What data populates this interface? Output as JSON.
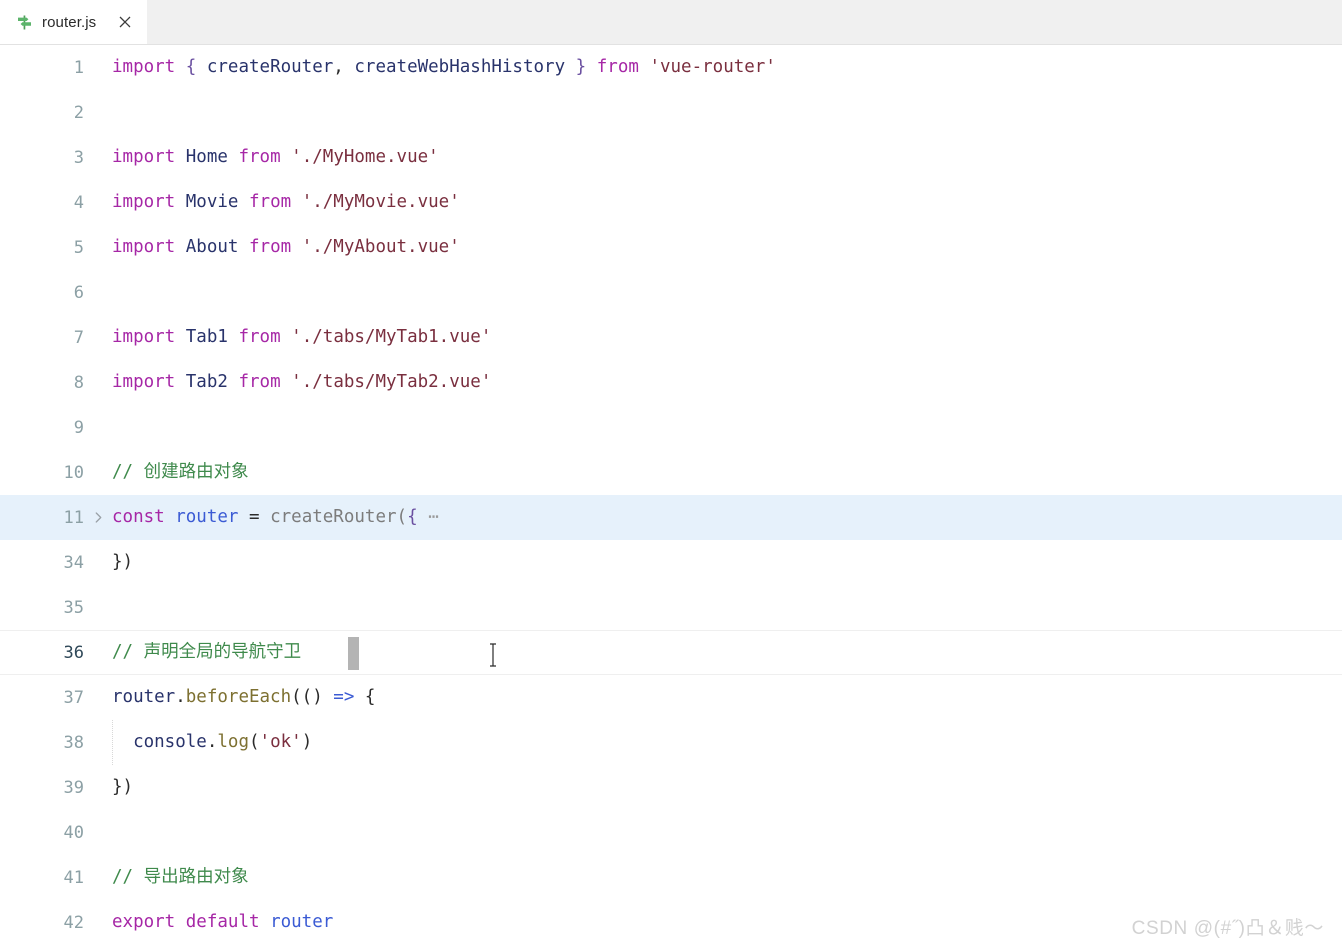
{
  "tab": {
    "label": "router.js",
    "icon": "router-signpost-icon",
    "close_icon": "close-icon"
  },
  "editor": {
    "fold_icon": "chevron-right-icon",
    "fold_placeholder": "⋯",
    "caret": "text-caret",
    "mouse_cursor": "i-beam-cursor",
    "lines": [
      {
        "n": "1",
        "state": "normal"
      },
      {
        "n": "2",
        "state": "normal"
      },
      {
        "n": "3",
        "state": "normal"
      },
      {
        "n": "4",
        "state": "normal"
      },
      {
        "n": "5",
        "state": "normal"
      },
      {
        "n": "6",
        "state": "normal"
      },
      {
        "n": "7",
        "state": "normal"
      },
      {
        "n": "8",
        "state": "normal"
      },
      {
        "n": "9",
        "state": "normal"
      },
      {
        "n": "10",
        "state": "normal"
      },
      {
        "n": "11",
        "state": "folded"
      },
      {
        "n": "34",
        "state": "normal"
      },
      {
        "n": "35",
        "state": "normal"
      },
      {
        "n": "36",
        "state": "current"
      },
      {
        "n": "37",
        "state": "normal"
      },
      {
        "n": "38",
        "state": "normal"
      },
      {
        "n": "39",
        "state": "normal"
      },
      {
        "n": "40",
        "state": "normal"
      },
      {
        "n": "41",
        "state": "normal"
      },
      {
        "n": "42",
        "state": "normal"
      }
    ],
    "code": {
      "l1_kw_import": "import",
      "l1_brace_open": "{",
      "l1_name1": "createRouter",
      "l1_comma": ",",
      "l1_name2": "createWebHashHistory",
      "l1_brace_close": "}",
      "l1_kw_from": "from",
      "l1_str": "'vue-router'",
      "l3_kw_import": "import",
      "l3_name": "Home",
      "l3_kw_from": "from",
      "l3_str": "'./MyHome.vue'",
      "l4_kw_import": "import",
      "l4_name": "Movie",
      "l4_kw_from": "from",
      "l4_str": "'./MyMovie.vue'",
      "l5_kw_import": "import",
      "l5_name": "About",
      "l5_kw_from": "from",
      "l5_str": "'./MyAbout.vue'",
      "l7_kw_import": "import",
      "l7_name": "Tab1",
      "l7_kw_from": "from",
      "l7_str": "'./tabs/MyTab1.vue'",
      "l8_kw_import": "import",
      "l8_name": "Tab2",
      "l8_kw_from": "from",
      "l8_str": "'./tabs/MyTab2.vue'",
      "l10_comment": "// 创建路由对象",
      "l11_kw_const": "const",
      "l11_var": "router",
      "l11_eq": "=",
      "l11_call": "createRouter(",
      "l11_brace": "{",
      "l34_close": "})",
      "l36_comment": "// 声明全局的导航守卫",
      "l37_obj": "router",
      "l37_dot": ".",
      "l37_fn": "beforeEach",
      "l37_args": "(()",
      "l37_arrow": "=>",
      "l37_brace": "{",
      "l38_obj": "console",
      "l38_dot": ".",
      "l38_fn": "log",
      "l38_paren_open": "(",
      "l38_str": "'ok'",
      "l38_paren_close": ")",
      "l39_close": "})",
      "l41_comment": "// 导出路由对象",
      "l42_kw_export": "export",
      "l42_kw_default": "default",
      "l42_var": "router"
    }
  },
  "watermark": "CSDN @(#˝)凸＆贱～",
  "colors": {
    "tabbar_bg": "#f0f0f0",
    "editor_bg": "#ffffff",
    "folded_highlight": "#e6f1fb",
    "keyword": "#a627a6",
    "string": "#7a2f3f",
    "comment": "#3f8a4c",
    "identifier": "#29336b",
    "variable": "#3b5bd4",
    "method": "#7d7031",
    "linenumber": "#8ca0a5",
    "linenumber_active": "#2f4858",
    "caret": "#b4b4b4"
  }
}
